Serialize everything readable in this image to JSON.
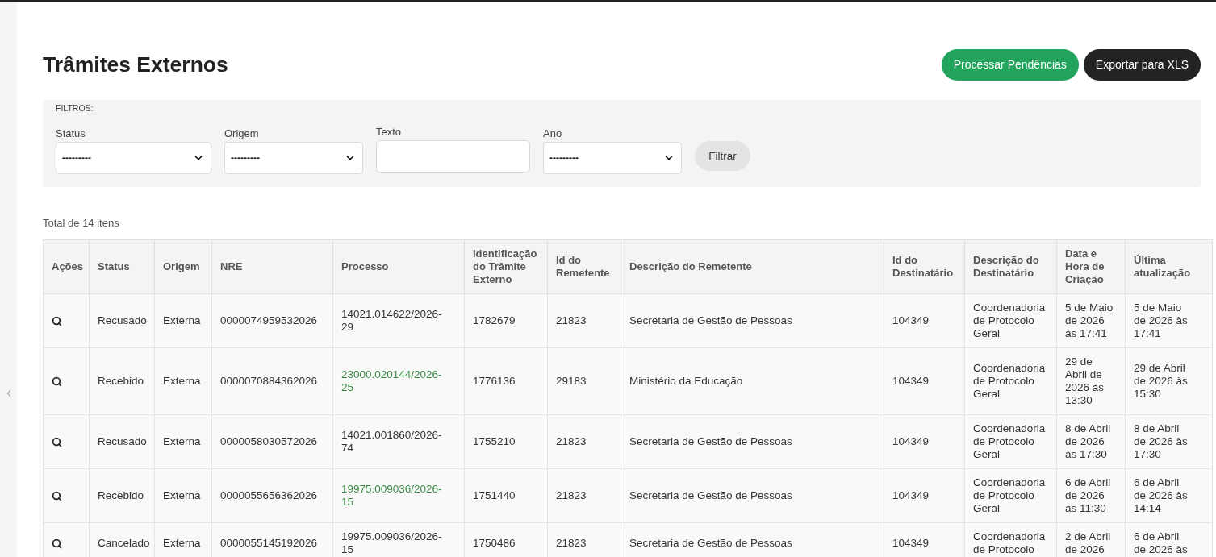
{
  "page": {
    "title": "Trâmites Externos",
    "actions": [
      {
        "kind": "primary",
        "label": "Processar Pendências"
      },
      {
        "kind": "dark",
        "label": "Exportar para XLS"
      }
    ]
  },
  "filters": {
    "legend": "FILTROS:",
    "fields": [
      {
        "kind": "select",
        "label": "Status",
        "value": "---------"
      },
      {
        "kind": "select",
        "label": "Origem",
        "value": "---------"
      },
      {
        "kind": "text",
        "label": "Texto"
      },
      {
        "kind": "select",
        "label": "Ano",
        "value": "---------"
      }
    ],
    "button": "Filtrar"
  },
  "summary": "Total de 14 itens",
  "table": {
    "columns": [
      "Ações",
      "Status",
      "Origem",
      "NRE",
      "Processo",
      "Identificação do Trâmite Externo",
      "Id do Remetente",
      "Descrição do Remetente",
      "Id do Destinatário",
      "Descrição do Destinatário",
      "Data e Hora de Criação",
      "Última atualização"
    ],
    "rows": [
      {
        "status": "Recusado",
        "origem": "Externa",
        "nre": "0000074959532026",
        "processo": "14021.014622/2026-29",
        "linked": false,
        "identificacao": "1782679",
        "id_remetente": "21823",
        "descricao_remetente": "Secretaria de Gestão de Pessoas",
        "id_destinatario": "104349",
        "descricao_destinatario": "Coordenadoria de Protocolo Geral",
        "data_criacao": "5 de Maio de 2026 às 17:41",
        "ultima_atualizacao": "5 de Maio de 2026 às 17:41"
      },
      {
        "status": "Recebido",
        "origem": "Externa",
        "nre": "0000070884362026",
        "processo": "23000.020144/2026-25",
        "linked": true,
        "identificacao": "1776136",
        "id_remetente": "29183",
        "descricao_remetente": "Ministério da Educação",
        "id_destinatario": "104349",
        "descricao_destinatario": "Coordenadoria de Protocolo Geral",
        "data_criacao": "29 de Abril de 2026 às 13:30",
        "ultima_atualizacao": "29 de Abril de 2026 às 15:30"
      },
      {
        "status": "Recusado",
        "origem": "Externa",
        "nre": "0000058030572026",
        "processo": "14021.001860/2026-74",
        "linked": false,
        "identificacao": "1755210",
        "id_remetente": "21823",
        "descricao_remetente": "Secretaria de Gestão de Pessoas",
        "id_destinatario": "104349",
        "descricao_destinatario": "Coordenadoria de Protocolo Geral",
        "data_criacao": "8 de Abril de 2026 às 17:30",
        "ultima_atualizacao": "8 de Abril de 2026 às 17:30"
      },
      {
        "status": "Recebido",
        "origem": "Externa",
        "nre": "0000055656362026",
        "processo": "19975.009036/2026-15",
        "linked": true,
        "identificacao": "1751440",
        "id_remetente": "21823",
        "descricao_remetente": "Secretaria de Gestão de Pessoas",
        "id_destinatario": "104349",
        "descricao_destinatario": "Coordenadoria de Protocolo Geral",
        "data_criacao": "6 de Abril de 2026 às 11:30",
        "ultima_atualizacao": "6 de Abril de 2026 às 14:14"
      },
      {
        "status": "Cancelado",
        "origem": "Externa",
        "nre": "0000055145192026",
        "processo": "19975.009036/2026-15",
        "linked": false,
        "identificacao": "1750486",
        "id_remetente": "21823",
        "descricao_remetente": "Secretaria de Gestão de Pessoas",
        "id_destinatario": "104349",
        "descricao_destinatario": "Coordenadoria de Protocolo",
        "data_criacao": "2 de Abril de 2026",
        "ultima_atualizacao": "6 de Abril de 2026 às"
      }
    ]
  }
}
